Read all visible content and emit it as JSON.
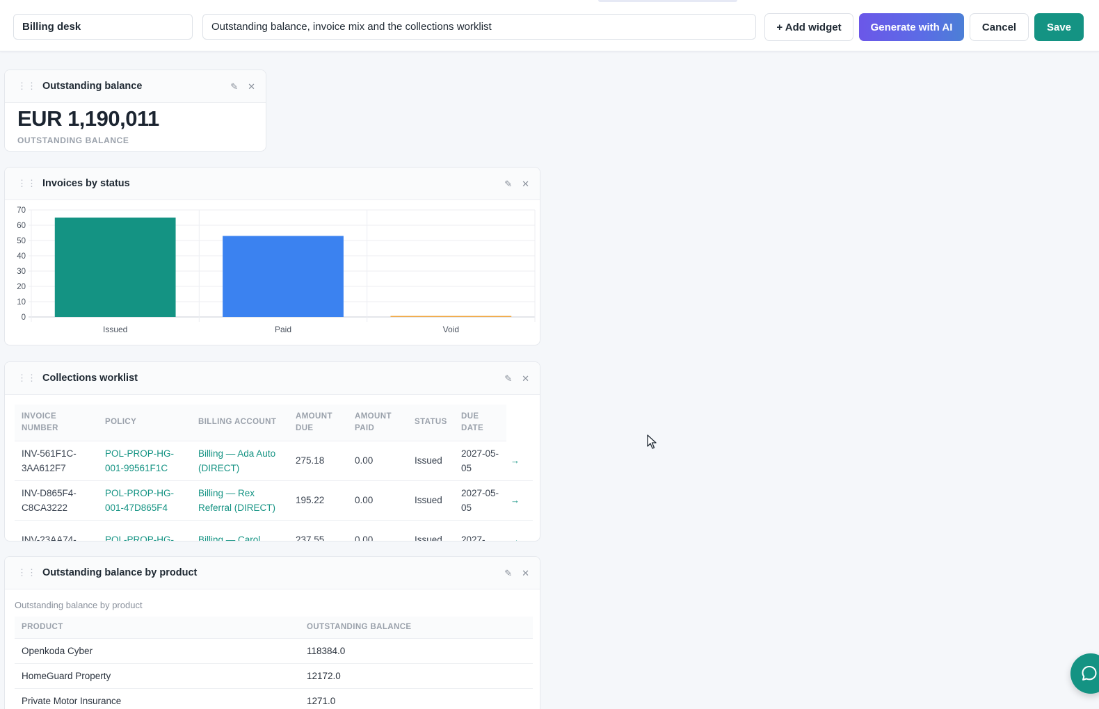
{
  "toolbar": {
    "dashboard_name": "Billing desk",
    "dashboard_description": "Outstanding balance, invoice mix and the collections worklist",
    "add_widget_label": "+ Add widget",
    "generate_ai_label": "Generate with AI",
    "cancel_label": "Cancel",
    "save_label": "Save"
  },
  "widgets": {
    "kpi": {
      "title": "Outstanding balance",
      "value": "EUR 1,190,011",
      "caption": "OUTSTANDING BALANCE"
    },
    "invoices_chart": {
      "title": "Invoices by status"
    },
    "collections": {
      "title": "Collections worklist",
      "columns": [
        "INVOICE NUMBER",
        "POLICY",
        "BILLING ACCOUNT",
        "AMOUNT DUE",
        "AMOUNT PAID",
        "STATUS",
        "DUE DATE"
      ],
      "rows": [
        {
          "invoice": "INV-561F1C-3AA612F7",
          "policy": "POL-PROP-HG-001-99561F1C",
          "account": "Billing — Ada Auto (DIRECT)",
          "amount_due": "275.18",
          "amount_paid": "0.00",
          "status": "Issued",
          "due_date": "2027-05-05",
          "open": "→"
        },
        {
          "invoice": "INV-D865F4-C8CA3222",
          "policy": "POL-PROP-HG-001-47D865F4",
          "account": "Billing — Rex Referral (DIRECT)",
          "amount_due": "195.22",
          "amount_paid": "0.00",
          "status": "Issued",
          "due_date": "2027-05-05",
          "open": "→"
        },
        {
          "invoice": "INV-23AA74-",
          "policy": "POL-PROP-HG-",
          "account": "Billing — Carol",
          "amount_due": "237.55",
          "amount_paid": "0.00",
          "status": "Issued",
          "due_date": "2027-",
          "open": "→"
        }
      ]
    },
    "by_product": {
      "title": "Outstanding balance by product",
      "caption": "Outstanding balance by product",
      "columns": [
        "PRODUCT",
        "OUTSTANDING BALANCE"
      ],
      "rows": [
        {
          "product": "Openkoda Cyber",
          "balance": "118384.0"
        },
        {
          "product": "HomeGuard Property",
          "balance": "12172.0"
        },
        {
          "product": "Private Motor Insurance",
          "balance": "1271.0"
        }
      ]
    }
  },
  "icons": {
    "drag": "drag-handle-icon",
    "edit": "pencil-icon",
    "close": "close-icon",
    "chat": "chat-bubble-icon"
  },
  "colors": {
    "accent": "#149383",
    "ai_gradient_start": "#6b57e8",
    "ai_gradient_end": "#4c7fd6",
    "bar_issued": "#149383",
    "bar_paid": "#3b82f0",
    "bar_void": "#f0a742"
  },
  "chart_data": {
    "type": "bar",
    "title": "Invoices by status",
    "categories": [
      "Issued",
      "Paid",
      "Void"
    ],
    "values": [
      65,
      53,
      0.5
    ],
    "colors": [
      "#149383",
      "#3b82f0",
      "#f0a742"
    ],
    "ylim": [
      0,
      70
    ],
    "yticks": [
      0,
      10,
      20,
      30,
      40,
      50,
      60,
      70
    ],
    "xlabel": "",
    "ylabel": "",
    "grid": true,
    "legend": "none"
  }
}
